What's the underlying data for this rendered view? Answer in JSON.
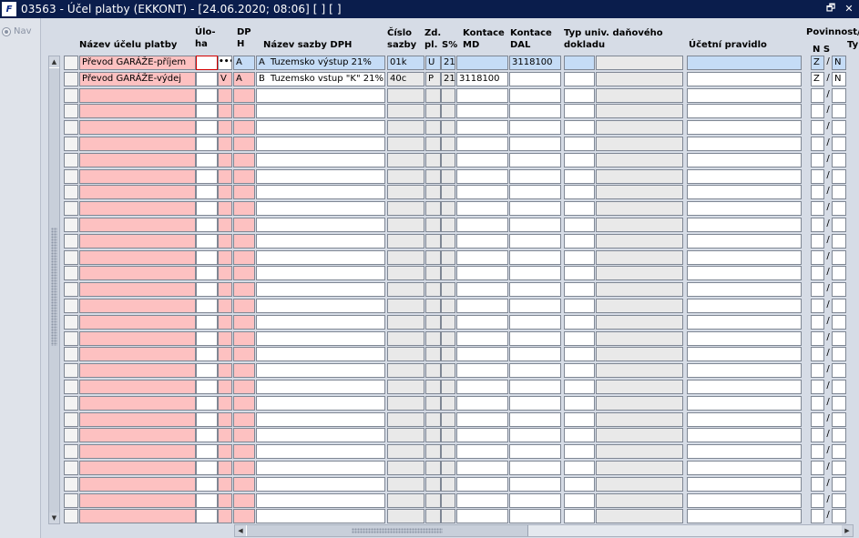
{
  "window": {
    "app_icon_label": "F",
    "title": "03563 - Účel platby (EKKONT) - [24.06.2020; 08:06]  [ ]  [ ]",
    "restore_glyph": "🗗",
    "close_glyph": "✕"
  },
  "left_pane": {
    "nav_label": "Nav"
  },
  "headers": {
    "nazev_ucelu": "Název účelu platby",
    "uloha": "Úlo-\nha",
    "dph": "DP\nH",
    "nazev_sazby": "Název sazby DPH",
    "cislo_sazby": "Číslo\nsazby",
    "zd_pl": "Zd.\npl.",
    "s_pct": "S%",
    "kontace_md": "Kontace\nMD",
    "kontace_dal": "Kontace\nDAL",
    "typ_univ": "Typ univ. daňového\ndokladu",
    "ucetni_pravidlo": "Účetní pravidlo",
    "povinnost": "Povinnost/",
    "ns": "N S",
    "ty": "Ty"
  },
  "rows": [
    {
      "nazev": "Převod GARÁŽE-příjem",
      "uloha": "",
      "lov": "•••",
      "dph_flag": "",
      "dph": "A",
      "sazba_code": "A",
      "sazba_nazev": "Tuzemsko výstup 21%",
      "cislo": "01k",
      "zd": "U",
      "s": "21",
      "md": "",
      "dal": "3118100",
      "typ1": "",
      "typ2": "",
      "pravidlo": "",
      "ns": "Z",
      "slash": "/",
      "ty": "N"
    },
    {
      "nazev": "Převod GARÁŽE-výdej",
      "uloha": "",
      "lov": "",
      "dph_flag": "V",
      "dph": "A",
      "sazba_code": "B",
      "sazba_nazev": "Tuzemsko vstup \"K\" 21%",
      "cislo": "40c",
      "zd": "P",
      "s": "21",
      "md": "3118100",
      "dal": "",
      "typ1": "",
      "typ2": "",
      "pravidlo": "",
      "ns": "Z",
      "slash": "/",
      "ty": "N"
    }
  ],
  "empty_row_slash": "/",
  "scroll": {
    "up": "▲",
    "down": "▼",
    "left": "◀",
    "right": "▶"
  }
}
